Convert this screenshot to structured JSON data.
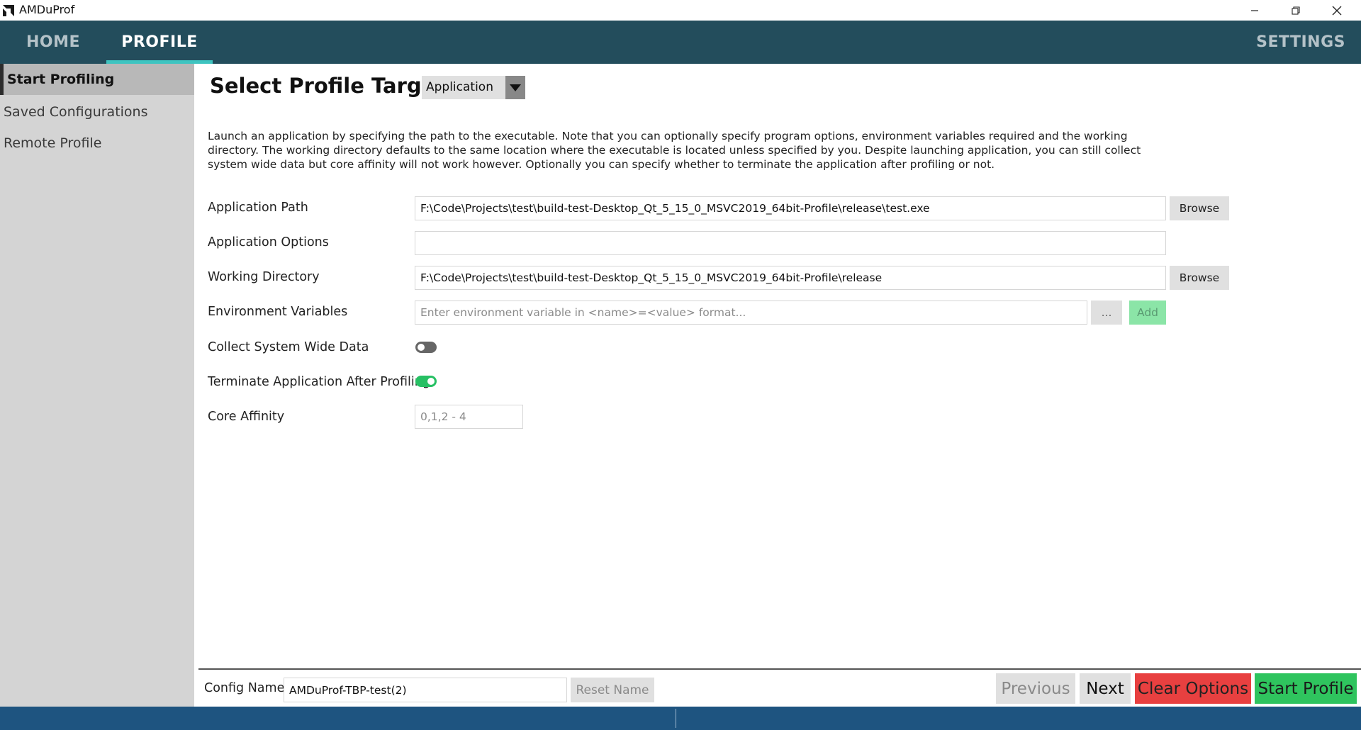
{
  "window": {
    "title": "AMDuProf"
  },
  "nav": {
    "home": "HOME",
    "profile": "PROFILE",
    "settings": "SETTINGS"
  },
  "sidebar": {
    "items": [
      {
        "label": "Start Profiling",
        "active": true
      },
      {
        "label": "Saved Configurations",
        "active": false
      },
      {
        "label": "Remote Profile",
        "active": false
      }
    ]
  },
  "main": {
    "heading": "Select Profile Target",
    "target_select": "Application",
    "description": "Launch an application by specifying the path to the executable. Note that you can optionally specify program options, environment variables required and the working directory. The working directory defaults to the same location where the executable is located unless specified by you. Despite launching application, you can still collect system wide data but core affinity will not work however. Optionally you can specify whether to terminate the application after profiling or not.",
    "fields": {
      "app_path": {
        "label": "Application Path",
        "value": "F:\\Code\\Projects\\test\\build-test-Desktop_Qt_5_15_0_MSVC2019_64bit-Profile\\release\\test.exe",
        "browse": "Browse"
      },
      "app_options": {
        "label": "Application Options",
        "value": ""
      },
      "working_dir": {
        "label": "Working Directory",
        "value": "F:\\Code\\Projects\\test\\build-test-Desktop_Qt_5_15_0_MSVC2019_64bit-Profile\\release",
        "browse": "Browse"
      },
      "env_vars": {
        "label": "Environment Variables",
        "placeholder": "Enter environment variable in <name>=<value> format...",
        "more": "...",
        "add": "Add"
      },
      "collect_system": {
        "label": "Collect System Wide Data",
        "enabled": false
      },
      "terminate_app": {
        "label": "Terminate Application After Profiling",
        "enabled": true
      },
      "core_affinity": {
        "label": "Core Affinity",
        "placeholder": "0,1,2 - 4"
      }
    }
  },
  "footer": {
    "config_label": "Config Name",
    "config_value": "AMDuProf-TBP-test(2)",
    "reset_name": "Reset Name",
    "previous": "Previous",
    "next": "Next",
    "clear": "Clear Options",
    "start": "Start Profile"
  },
  "colors": {
    "nav_bg": "#234d5c",
    "nav_accent": "#3ec4c0",
    "clear_red": "#e84040",
    "start_green": "#2fc45e",
    "toggle_on": "#27c064",
    "add_green": "#8be5a7",
    "status_bar": "#1e5480"
  }
}
